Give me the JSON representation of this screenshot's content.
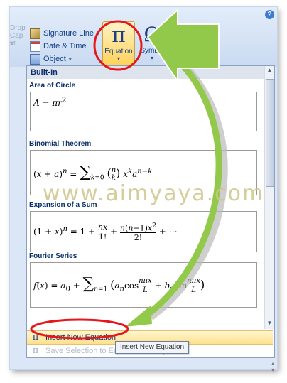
{
  "ribbon": {
    "help_label": "?",
    "left_stub": [
      "Drop",
      "Cap ▾",
      "xt"
    ],
    "signature_line": "Signature Line",
    "date_time": "Date & Time",
    "object": "Object",
    "equation": {
      "glyph": "π",
      "label": "Equation"
    },
    "symbol": {
      "glyph": "Ω",
      "label": "Symbol"
    }
  },
  "gallery": {
    "section": "Built-In",
    "equations": [
      {
        "title": "Area of Circle"
      },
      {
        "title": "Binomial Theorem"
      },
      {
        "title": "Expansion of a Sum"
      },
      {
        "title": "Fourier Series"
      }
    ],
    "insert_new_equation": "Insert New Equation",
    "save_selection": "Save Selection to Equation Gallery..."
  },
  "tooltip": "Insert New Equation",
  "watermark": "www.aimyaya.com",
  "colors": {
    "highlight_red": "#e5171b",
    "arrow_green": "#92c84a",
    "ribbon_blue": "#15428b"
  },
  "icons": {
    "help": "help-icon",
    "signature": "signature-line-icon",
    "date": "calendar-icon",
    "object": "object-icon",
    "equation": "pi-icon",
    "symbol": "omega-icon"
  }
}
